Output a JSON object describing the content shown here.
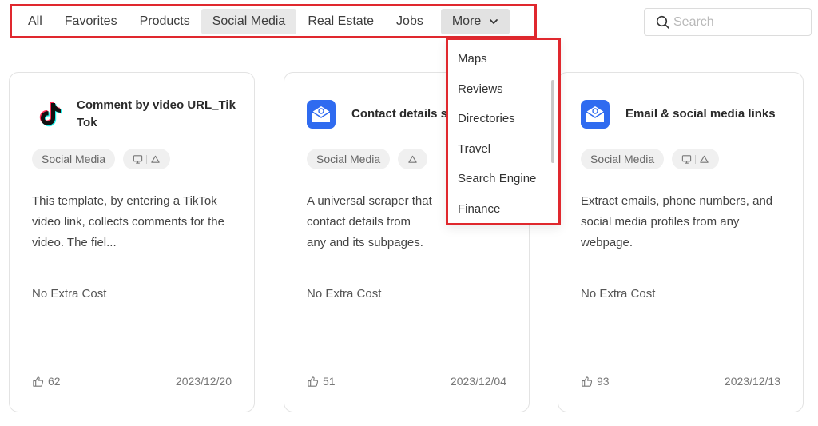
{
  "tabs": [
    {
      "label": "All",
      "active": false
    },
    {
      "label": "Favorites",
      "active": false
    },
    {
      "label": "Products",
      "active": false
    },
    {
      "label": "Social Media",
      "active": true
    },
    {
      "label": "Real Estate",
      "active": false
    },
    {
      "label": "Jobs",
      "active": false
    }
  ],
  "more": {
    "label": "More",
    "icon": "chevron-down-icon",
    "items": [
      "Maps",
      "Reviews",
      "Directories",
      "Travel",
      "Search Engine",
      "Finance"
    ]
  },
  "search": {
    "placeholder": "Search",
    "icon": "search-icon"
  },
  "cards": [
    {
      "title": "Comment by video URL_TikTok",
      "icon": "tiktok-logo-icon",
      "tag": "Social Media",
      "platform_icons": [
        "desktop-icon",
        "cloud-icon"
      ],
      "description": "This template, by entering a TikTok video link, collects comments for the video. The fiel...",
      "cost": "No Extra Cost",
      "likes": "62",
      "date": "2023/12/20"
    },
    {
      "title": "Contact details s",
      "icon": "email-envelope-icon",
      "tag": "Social Media",
      "platform_icons": [
        "cloud-icon"
      ],
      "description": "A universal scraper that contact details from any and its subpages.",
      "cost": "No Extra Cost",
      "likes": "51",
      "date": "2023/12/04"
    },
    {
      "title": "Email & social media links",
      "icon": "email-envelope-icon",
      "tag": "Social Media",
      "platform_icons": [
        "desktop-icon",
        "cloud-icon"
      ],
      "description": "Extract emails, phone numbers, and social media profiles from any webpage.",
      "cost": "No Extra Cost",
      "likes": "93",
      "date": "2023/12/13"
    }
  ],
  "colors": {
    "highlight_border": "#e0282e",
    "active_tab_bg": "#e8e8e8",
    "tag_bg": "#f0f0f0",
    "envelope_blue": "#2f6bf0"
  }
}
